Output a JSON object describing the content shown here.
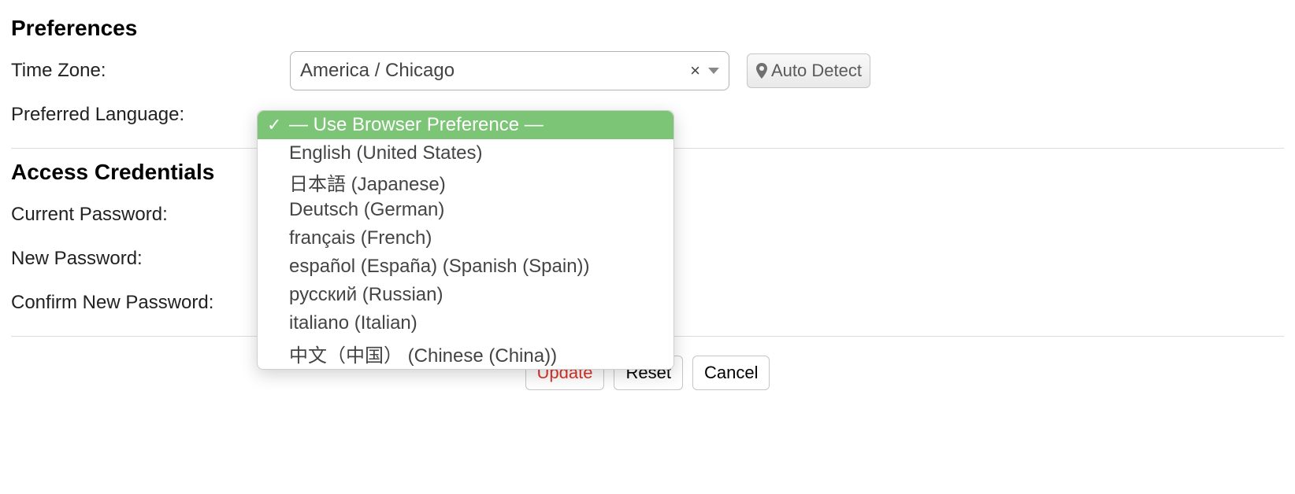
{
  "preferences": {
    "title": "Preferences",
    "timezone_label": "Time Zone:",
    "timezone_value": "America / Chicago",
    "auto_detect_label": "Auto Detect",
    "language_label": "Preferred Language:",
    "language_options": [
      "— Use Browser Preference —",
      "English (United States)",
      "日本語 (Japanese)",
      "Deutsch (German)",
      "français (French)",
      "español (España) (Spanish (Spain))",
      "русский (Russian)",
      "italiano (Italian)",
      "中文（中国） (Chinese (China))"
    ]
  },
  "credentials": {
    "title": "Access Credentials",
    "current_password_label": "Current Password:",
    "new_password_label": "New Password:",
    "confirm_password_label": "Confirm New Password:"
  },
  "actions": {
    "update": "Update",
    "reset": "Reset",
    "cancel": "Cancel"
  }
}
